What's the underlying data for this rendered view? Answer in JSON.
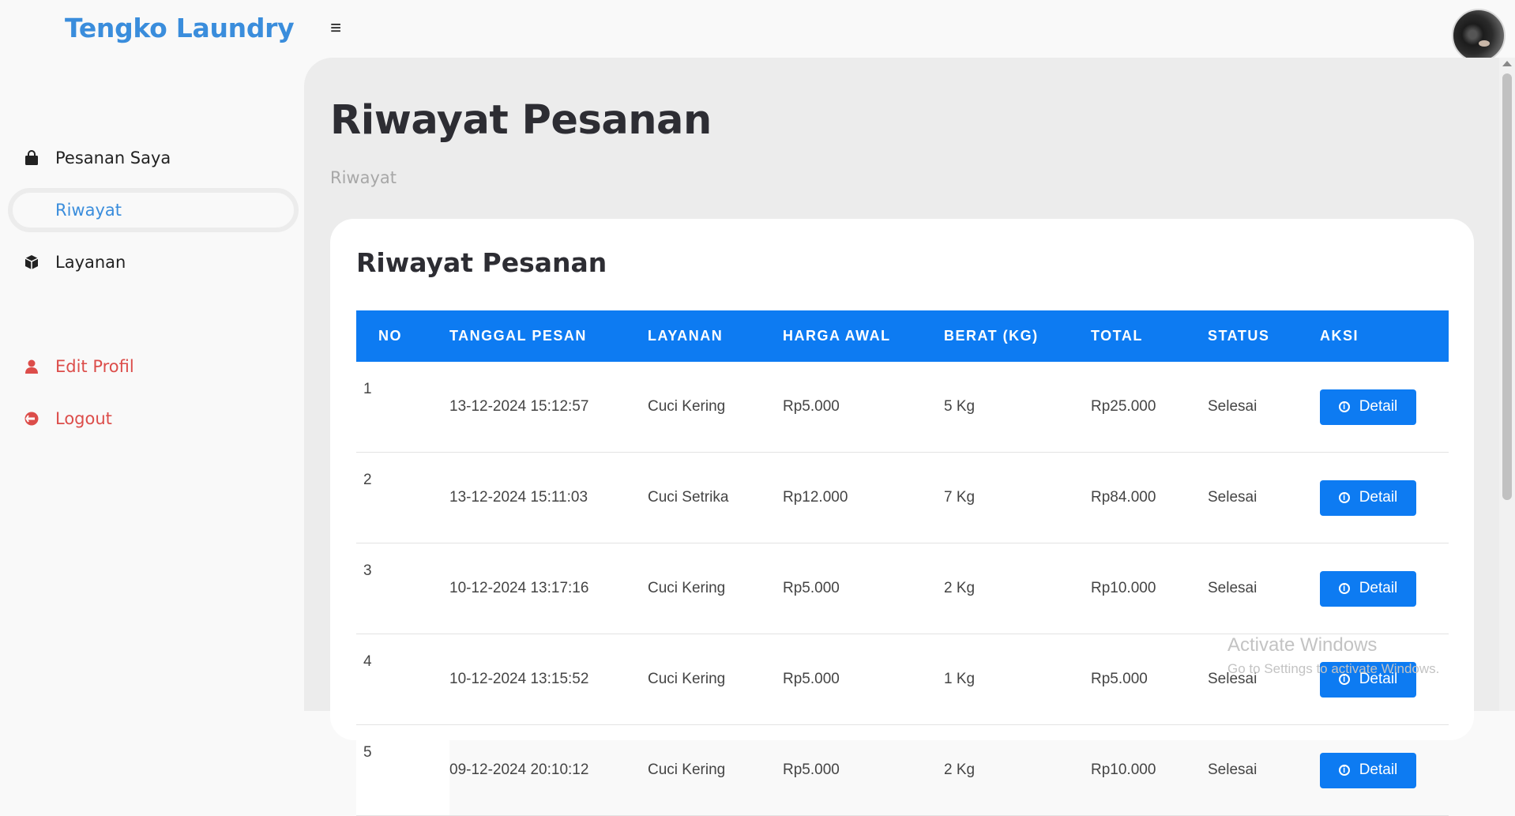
{
  "brand": "Tengko Laundry",
  "header": {
    "menu_icon": "≡"
  },
  "sidebar": {
    "items": [
      {
        "label": "Pesanan Saya",
        "icon": "shopping-bag-icon"
      },
      {
        "label": "Riwayat",
        "icon": ""
      },
      {
        "label": "Layanan",
        "icon": "box-icon"
      },
      {
        "label": "Edit Profil",
        "icon": "user-icon"
      },
      {
        "label": "Logout",
        "icon": "logout-icon"
      }
    ]
  },
  "page": {
    "title": "Riwayat Pesanan",
    "breadcrumb": "Riwayat"
  },
  "card": {
    "title": "Riwayat Pesanan"
  },
  "table": {
    "headers": [
      "NO",
      "TANGGAL PESAN",
      "LAYANAN",
      "HARGA AWAL",
      "BERAT (KG)",
      "TOTAL",
      "STATUS",
      "AKSI"
    ],
    "rows": [
      {
        "no": "1",
        "tanggal": "13-12-2024 15:12:57",
        "layanan": "Cuci Kering",
        "harga": "Rp5.000",
        "berat": "5 Kg",
        "total": "Rp25.000",
        "status": "Selesai",
        "aksi": "Detail"
      },
      {
        "no": "2",
        "tanggal": "13-12-2024 15:11:03",
        "layanan": "Cuci Setrika",
        "harga": "Rp12.000",
        "berat": "7 Kg",
        "total": "Rp84.000",
        "status": "Selesai",
        "aksi": "Detail"
      },
      {
        "no": "3",
        "tanggal": "10-12-2024 13:17:16",
        "layanan": "Cuci Kering",
        "harga": "Rp5.000",
        "berat": "2 Kg",
        "total": "Rp10.000",
        "status": "Selesai",
        "aksi": "Detail"
      },
      {
        "no": "4",
        "tanggal": "10-12-2024 13:15:52",
        "layanan": "Cuci Kering",
        "harga": "Rp5.000",
        "berat": "1 Kg",
        "total": "Rp5.000",
        "status": "Selesai",
        "aksi": "Detail"
      },
      {
        "no": "5",
        "tanggal": "09-12-2024 20:10:12",
        "layanan": "Cuci Kering",
        "harga": "Rp5.000",
        "berat": "2 Kg",
        "total": "Rp10.000",
        "status": "Selesai",
        "aksi": "Detail"
      }
    ]
  },
  "watermark": {
    "line1": "Activate Windows",
    "line2": "Go to Settings to activate Windows."
  },
  "colors": {
    "accent": "#0d7bf2",
    "brand": "#3a8ddc",
    "danger": "#dc4d4a"
  }
}
